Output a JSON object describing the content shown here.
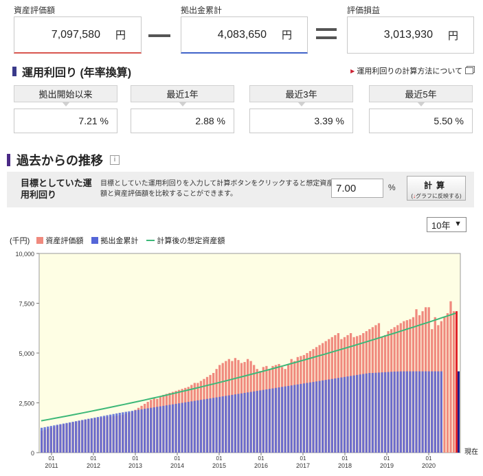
{
  "summary": {
    "valuation": {
      "label": "資産評価額",
      "value": "7,097,580",
      "unit": "円"
    },
    "contribution": {
      "label": "拠出金累計",
      "value": "4,083,650",
      "unit": "円"
    },
    "profit": {
      "label": "評価損益",
      "value": "3,013,930",
      "unit": "円"
    }
  },
  "yield": {
    "title": "運用利回り (年率換算)",
    "method_link": "運用利回りの計算方法について",
    "periods": [
      {
        "label": "拠出開始以来",
        "value": "7.21 %"
      },
      {
        "label": "最近1年",
        "value": "2.88 %"
      },
      {
        "label": "最近3年",
        "value": "3.39 %"
      },
      {
        "label": "最近5年",
        "value": "5.50 %"
      }
    ]
  },
  "history": {
    "title": "過去からの推移",
    "info_icon": "info-icon",
    "target": {
      "label": "目標としていた運用利回り",
      "description": "目標としていた運用利回りを入力して計算ボタンをクリックすると想定資産額と資産評価額を比較することができます。",
      "value": "7.00",
      "unit": "%",
      "button_main": "計算",
      "button_sub_arrow": "↓",
      "button_sub": "グラフに反映する"
    },
    "period_select": "10年"
  },
  "chart_data": {
    "type": "bar",
    "unit_label": "(千円)",
    "legend": [
      "資産評価額",
      "拠出金累計",
      "計算後の想定資産額"
    ],
    "colors": {
      "valuation": "#f08a7e",
      "contribution": "#5566d8",
      "expected": "#3cb878",
      "background": "#fefee4"
    },
    "ylim": [
      0,
      10000
    ],
    "yticks": [
      "0",
      "2,500",
      "5,000",
      "7,500",
      "10,000"
    ],
    "xticks": [
      {
        "top": "01",
        "year": "2011"
      },
      {
        "top": "01",
        "year": "2012"
      },
      {
        "top": "01",
        "year": "2013"
      },
      {
        "top": "01",
        "year": "2014"
      },
      {
        "top": "01",
        "year": "2015"
      },
      {
        "top": "01",
        "year": "2016"
      },
      {
        "top": "01",
        "year": "2017"
      },
      {
        "top": "01",
        "year": "2018"
      },
      {
        "top": "01",
        "year": "2019"
      },
      {
        "top": "01",
        "year": "2020"
      }
    ],
    "current_label": "現在",
    "series": [
      {
        "name": "資産評価額",
        "values": [
          1100,
          1150,
          1200,
          1250,
          1300,
          1350,
          1400,
          1420,
          1450,
          1480,
          1520,
          1560,
          1600,
          1620,
          1650,
          1680,
          1700,
          1720,
          1740,
          1760,
          1780,
          1800,
          1820,
          1840,
          1860,
          1880,
          1900,
          1950,
          2000,
          2050,
          2150,
          2250,
          2350,
          2450,
          2550,
          2650,
          2750,
          2700,
          2800,
          2900,
          2950,
          3000,
          3050,
          3100,
          3150,
          3200,
          3250,
          3300,
          3400,
          3500,
          3500,
          3600,
          3700,
          3800,
          3900,
          4000,
          4200,
          4400,
          4500,
          4600,
          4700,
          4600,
          4750,
          4650,
          4500,
          4550,
          4700,
          4600,
          4400,
          4200,
          4100,
          4300,
          4350,
          4200,
          4350,
          4400,
          4450,
          4300,
          4200,
          4400,
          4700,
          4600,
          4800,
          4850,
          4900,
          5000,
          5100,
          5200,
          5300,
          5400,
          5500,
          5600,
          5700,
          5800,
          5900,
          6000,
          5700,
          5800,
          5900,
          6000,
          5800,
          5850,
          5900,
          6000,
          6100,
          6200,
          6300,
          6400,
          6500,
          5800,
          5900,
          6100,
          6200,
          6300,
          6400,
          6500,
          6600,
          6650,
          6700,
          6800,
          7200,
          6900,
          7100,
          7300,
          7300,
          6200,
          6800,
          6400,
          6600,
          6800,
          7000,
          7600,
          7100
        ],
        "current": 7100
      },
      {
        "name": "拠出金累計",
        "values": [
          1250,
          1280,
          1310,
          1340,
          1370,
          1400,
          1430,
          1460,
          1490,
          1520,
          1550,
          1580,
          1610,
          1640,
          1670,
          1700,
          1730,
          1760,
          1790,
          1820,
          1850,
          1880,
          1910,
          1940,
          1970,
          2000,
          2025,
          2050,
          2075,
          2100,
          2125,
          2150,
          2175,
          2200,
          2225,
          2250,
          2275,
          2300,
          2325,
          2350,
          2375,
          2400,
          2425,
          2450,
          2475,
          2500,
          2525,
          2550,
          2575,
          2600,
          2625,
          2650,
          2675,
          2700,
          2725,
          2750,
          2775,
          2800,
          2825,
          2850,
          2875,
          2900,
          2925,
          2950,
          2975,
          3000,
          3025,
          3050,
          3075,
          3100,
          3125,
          3150,
          3175,
          3200,
          3225,
          3250,
          3275,
          3300,
          3325,
          3350,
          3375,
          3400,
          3425,
          3450,
          3475,
          3500,
          3525,
          3550,
          3575,
          3600,
          3625,
          3650,
          3675,
          3700,
          3725,
          3750,
          3775,
          3800,
          3825,
          3850,
          3875,
          3900,
          3925,
          3950,
          3975,
          4000,
          4000,
          4010,
          4020,
          4030,
          4040,
          4050,
          4060,
          4070,
          4075,
          4080,
          4083,
          4083,
          4083,
          4083,
          4083,
          4083,
          4083,
          4083,
          4083,
          4083,
          4083,
          4083,
          4083
        ],
        "current": 4083
      },
      {
        "name": "計算後の想定資産額",
        "start": 1600,
        "end": 7000
      }
    ]
  }
}
